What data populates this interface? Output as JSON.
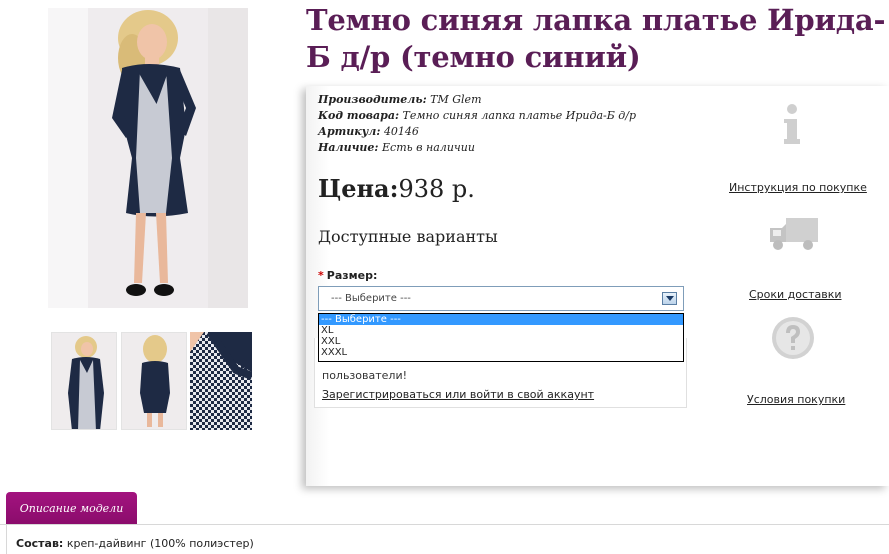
{
  "product": {
    "title": "Темно синяя лапка платье Ирида-Б д/р (темно синий)",
    "meta": [
      {
        "label": "Производитель:",
        "value": "TM Glem"
      },
      {
        "label": "Код товара:",
        "value": "Темно синяя лапка платье Ирида-Б д/р"
      },
      {
        "label": "Артикул:",
        "value": "40146"
      },
      {
        "label": "Наличие:",
        "value": "Есть в наличии"
      }
    ],
    "price_label": "Цена:",
    "price_value": "938 р.",
    "variants_title": "Доступные варианты"
  },
  "size_select": {
    "required_mark": "*",
    "label": "Размер:",
    "current": "--- Выберите ---",
    "options": [
      "--- Выберите ---",
      "XL",
      "XXL",
      "XXXL"
    ]
  },
  "login": {
    "text": "пользователи!",
    "link": "Зарегистрироваться или войти в свой аккаунт"
  },
  "side_links": {
    "instructions": "Инструкция по покупке",
    "delivery": "Сроки доставки",
    "terms": "Условия покупки"
  },
  "tabs": {
    "description": "Описание модели"
  },
  "composition": {
    "label": "Состав:",
    "value": "креп-дайвинг (100% полиэстер)"
  },
  "icons": {
    "info": "info-icon",
    "truck": "truck-icon",
    "help": "question-icon"
  },
  "colors": {
    "title": "#5a1e56",
    "tab": "#9a1078",
    "dress_navy": "#1e2a44"
  }
}
